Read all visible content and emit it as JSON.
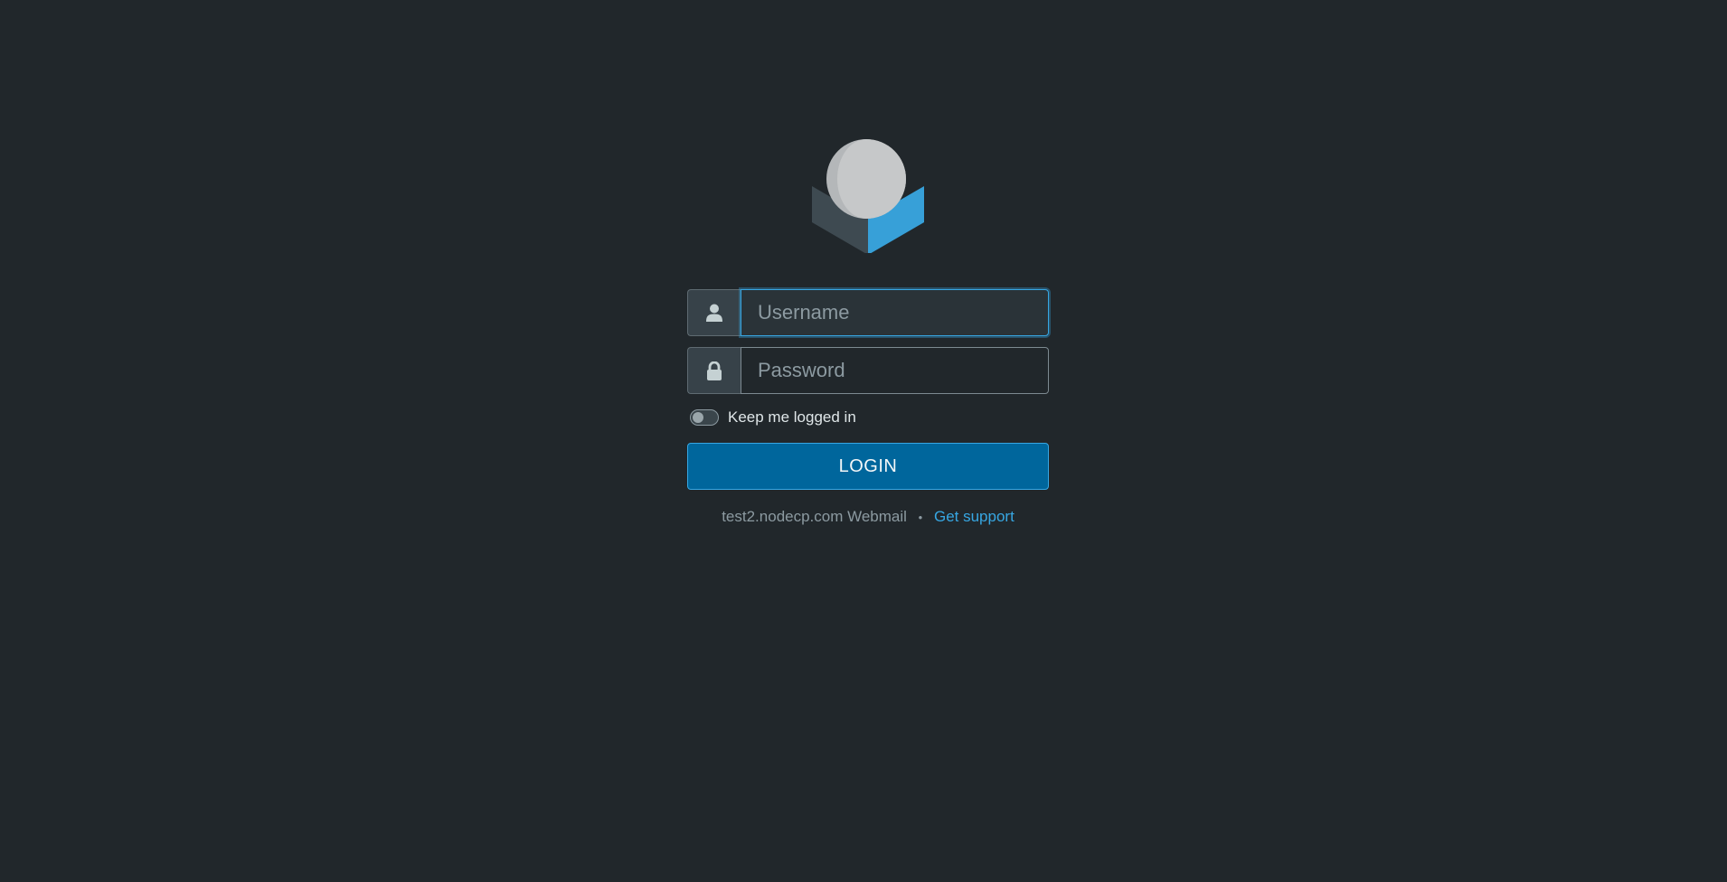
{
  "login": {
    "username_placeholder": "Username",
    "password_placeholder": "Password",
    "remember_label": "Keep me logged in",
    "remember_checked": false,
    "submit_label": "LOGIN"
  },
  "footer": {
    "product_name": "test2.nodecp.com Webmail",
    "separator": "•",
    "support_link": "Get support"
  },
  "icons": {
    "logo": "roundcube-logo",
    "username": "user-icon",
    "password": "lock-icon"
  },
  "colors": {
    "background": "#21272b",
    "accent": "#37a7e3",
    "button": "#00669c"
  }
}
